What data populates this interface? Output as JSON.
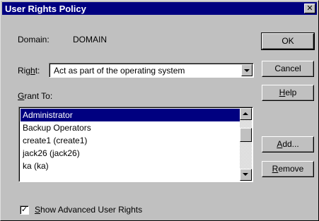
{
  "window": {
    "title": "User Rights Policy",
    "close_glyph": "✕"
  },
  "domain": {
    "label": "Domain:",
    "value": "DOMAIN"
  },
  "right": {
    "label_accel": "Rig",
    "label_underlined": "h",
    "label_rest": "t:",
    "selected_value": "Act as part of the operating system"
  },
  "grant_to": {
    "label_underlined": "G",
    "label_rest": "rant To:",
    "items": [
      {
        "label": "Administrator",
        "selected": true
      },
      {
        "label": "Backup Operators",
        "selected": false
      },
      {
        "label": "create1 (create1)",
        "selected": false
      },
      {
        "label": "jack26 (jack26)",
        "selected": false
      },
      {
        "label": "ka (ka)",
        "selected": false
      }
    ]
  },
  "buttons": {
    "ok": "OK",
    "cancel": "Cancel",
    "help_underlined": "H",
    "help_rest": "elp",
    "add_underlined": "A",
    "add_rest": "dd...",
    "remove_underlined": "R",
    "remove_rest": "emove"
  },
  "advanced": {
    "checked": true,
    "check_glyph": "✓",
    "label_underlined": "S",
    "label_rest": "how Advanced User Rights"
  }
}
